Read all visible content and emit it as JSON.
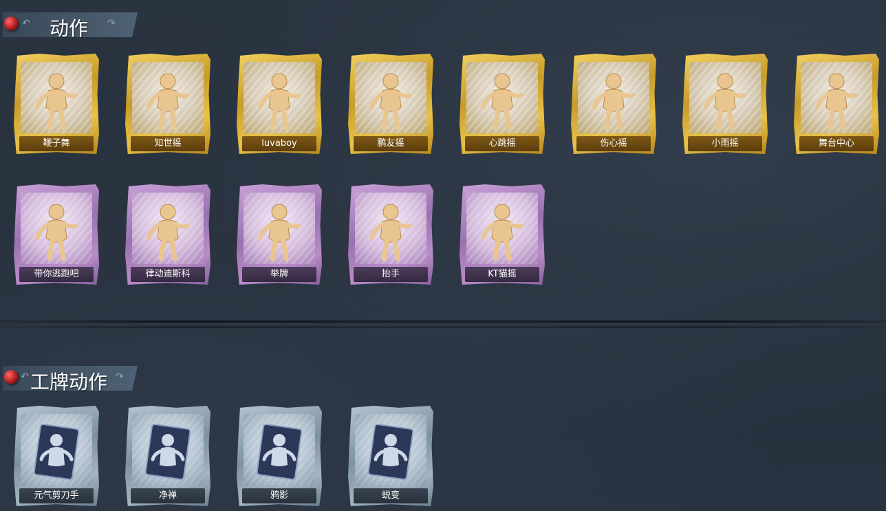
{
  "sections": {
    "actions": {
      "title": "动作",
      "rows": [
        [
          "鞭子舞",
          "知世摇",
          "luvaboy",
          "鹏友摇",
          "心跳摇",
          "伤心摇",
          "小雨摇",
          "舞台中心"
        ],
        [
          "带你逃跑吧",
          "律动迪斯科",
          "举牌",
          "抬手",
          "KT猫摇"
        ]
      ]
    },
    "badge_actions": {
      "title": "工牌动作",
      "rows": [
        [
          "元气剪刀手",
          "净禅",
          "鸦影",
          "蜕变"
        ]
      ]
    }
  },
  "tiers": {
    "gold": {
      "colors": [
        "#f2d060",
        "#c89c28"
      ],
      "items": [
        "鞭子舞",
        "知世摇",
        "luvaboy",
        "鹏友摇",
        "心跳摇",
        "伤心摇",
        "小雨摇",
        "舞台中心"
      ]
    },
    "purple": {
      "colors": [
        "#caa0d8",
        "#9a72b0"
      ],
      "items": [
        "带你逃跑吧",
        "律动迪斯科",
        "举牌",
        "抬手",
        "KT猫摇"
      ]
    },
    "steel": {
      "colors": [
        "#b4c4d0",
        "#7e92a2"
      ],
      "items": [
        "元气剪刀手",
        "净禅",
        "鸦影",
        "蜕变"
      ]
    }
  },
  "icons": {
    "gold": "dancer-silhouette-icon",
    "purple": "dancer-silhouette-icon",
    "steel": "badge-card-silhouette-icon"
  }
}
